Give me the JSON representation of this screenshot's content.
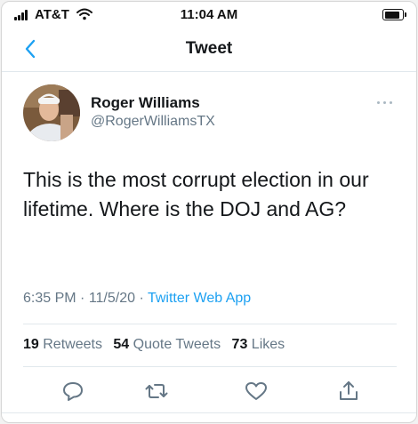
{
  "status_bar": {
    "carrier": "AT&T",
    "time": "11:04 AM",
    "battery_level": 0.85
  },
  "nav": {
    "title": "Tweet"
  },
  "tweet": {
    "display_name": "Roger Williams",
    "handle": "@RogerWilliamsTX",
    "text": "This is the most corrupt election in our lifetime. Where is the DOJ and AG?",
    "time": "6:35 PM",
    "date": "11/5/20",
    "separator": " · ",
    "source": "Twitter Web App",
    "stats": {
      "retweets_count": "19",
      "retweets_label": "Retweets",
      "quotes_count": "54",
      "quotes_label": "Quote Tweets",
      "likes_count": "73",
      "likes_label": "Likes"
    }
  },
  "colors": {
    "link": "#1da1f2",
    "secondary_text": "#657786",
    "primary_text": "#14171a",
    "divider": "#e1e8ed"
  },
  "icons": [
    "signal-icon",
    "wifi-icon",
    "battery-icon",
    "back-chevron-icon",
    "more-icon",
    "reply-icon",
    "retweet-icon",
    "like-icon",
    "share-icon"
  ]
}
